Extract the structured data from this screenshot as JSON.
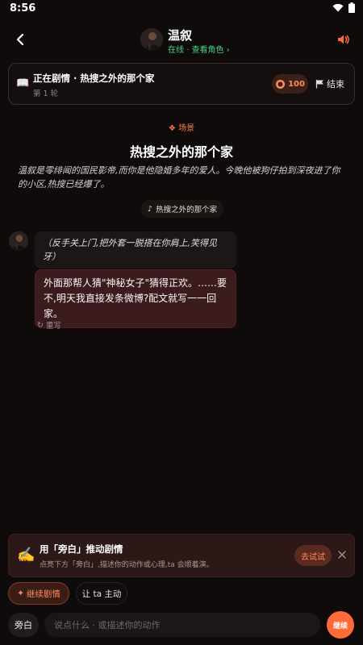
{
  "status_bar": {
    "time": "8:56"
  },
  "header": {
    "name": "温叙",
    "status_online": "在线",
    "status_separator": "·",
    "view_role": "查看角色 ›"
  },
  "story": {
    "title": "正在剧情 · 热搜之外的那个家",
    "round": "第 1 轮",
    "points": "100",
    "end_label": "结束"
  },
  "scene": {
    "tag": "场景",
    "title": "热搜之外的那个家",
    "description": "温叙是零绯闻的国民影帝,而你是他隐婚多年的爱人。今晚他被狗仔拍到深夜进了你的小区,热搜已经爆了。",
    "music": "热搜之外的那个家"
  },
  "messages": {
    "action": "（反手关上门,把外套一脱搭在你肩上,笑得见牙）",
    "speech": "外面那帮人猜\"神秘女子\"猜得正欢。……要不,明天我直接发条微博?配文就写一一回家。",
    "regenerate": "重写"
  },
  "tip": {
    "title": "用「旁白」推动剧情",
    "description": "点亮下方「旁白」,描述你的动作或心理,ta 会顺着演。",
    "try_label": "去试试"
  },
  "quick_actions": {
    "continue_label": "继续剧情",
    "active_label": "让 ta 主动"
  },
  "input_bar": {
    "narration_label": "旁白",
    "placeholder": "说点什么 · 或描述你的动作",
    "send_label": "继续"
  },
  "colors": {
    "accent": "#ff6a38",
    "online": "#4fd087",
    "background": "#0f0b0b",
    "speech_bubble": "#3b1b1d"
  },
  "icons": [
    "back-icon",
    "speaker-icon",
    "book-icon",
    "coin-icon",
    "flag-icon",
    "diamond-icon",
    "music-note-icon",
    "refresh-icon",
    "writing-hand-icon",
    "close-icon",
    "sparkle-icon"
  ]
}
